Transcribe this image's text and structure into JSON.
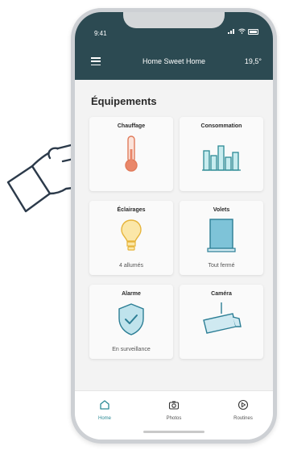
{
  "status_bar": {
    "time": "9:41"
  },
  "header": {
    "title": "Home Sweet Home",
    "temperature": "19,5°"
  },
  "section": {
    "title": "Équipements"
  },
  "tiles": [
    {
      "label": "Chauffage",
      "status": "",
      "icon": "thermometer-icon"
    },
    {
      "label": "Consommation",
      "status": "",
      "icon": "bar-chart-icon"
    },
    {
      "label": "Éclairages",
      "status": "4 allumés",
      "icon": "lightbulb-icon"
    },
    {
      "label": "Volets",
      "status": "Tout fermé",
      "icon": "shutter-icon"
    },
    {
      "label": "Alarme",
      "status": "En surveillance",
      "icon": "shield-check-icon"
    },
    {
      "label": "Caméra",
      "status": "",
      "icon": "camera-icon"
    }
  ],
  "bottom_nav": [
    {
      "label": "Home",
      "icon": "house-icon",
      "active": true
    },
    {
      "label": "Photos",
      "icon": "camera-photo-icon",
      "active": false
    },
    {
      "label": "Routines",
      "icon": "routine-icon",
      "active": false
    }
  ],
  "colors": {
    "header_bg": "#2c4a52",
    "accent": "#2c8a95",
    "heat": "#e9876a",
    "light": "#f2c14e"
  }
}
